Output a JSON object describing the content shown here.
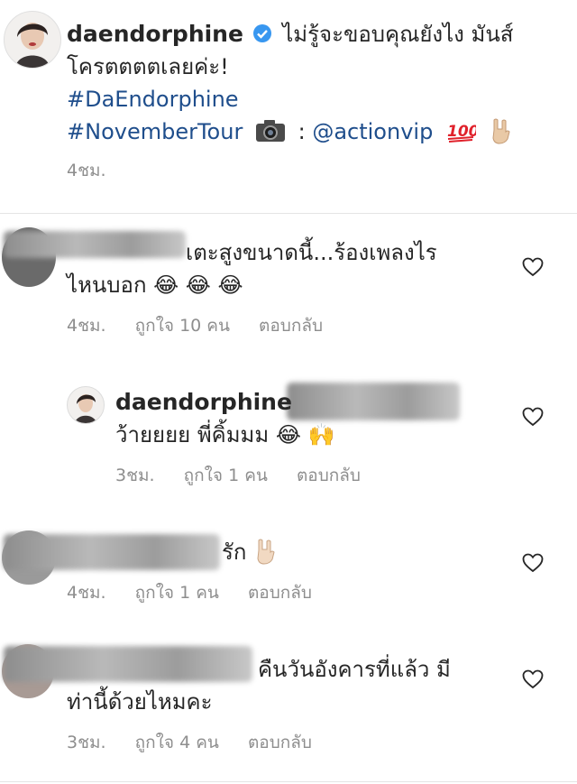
{
  "post": {
    "author": "daendorphine",
    "caption_line1": "ไม่รู้จะขอบคุณยังไง มันส์",
    "caption_line2": "โครตตตตเลยค่ะ!",
    "hashtag1": "#DaEndorphine",
    "hashtag2": "#NovemberTour",
    "credit_sep": ":",
    "credit": "@actionvip",
    "time": "4ชม.",
    "verified_icon": "verified-badge-icon"
  },
  "comments": [
    {
      "text_line1": "เตะสูงขนาดนี้...ร้องเพลงไร",
      "text_line2": "ไหนบอก",
      "time": "4ชม.",
      "likes": "ถูกใจ 10 คน",
      "reply": "ตอบกลับ"
    },
    {
      "author": "daendorphine",
      "text_line1": "ว้ายยยย พี่คิ้มมม",
      "time": "3ชม.",
      "likes": "ถูกใจ 1 คน",
      "reply": "ตอบกลับ"
    },
    {
      "text_line1": "รัก",
      "time": "4ชม.",
      "likes": "ถูกใจ 1 คน",
      "reply": "ตอบกลับ"
    },
    {
      "text_line1": "คืนวันอังคารที่แล้ว มี",
      "text_line2": "ท่านี้ด้วยไหมคะ",
      "time": "3ชม.",
      "likes": "ถูกใจ 4 คน",
      "reply": "ตอบกลับ"
    }
  ],
  "colors": {
    "hashtag": "#1f4e8c",
    "meta": "#8e8e8e",
    "verified": "#3897f0"
  }
}
